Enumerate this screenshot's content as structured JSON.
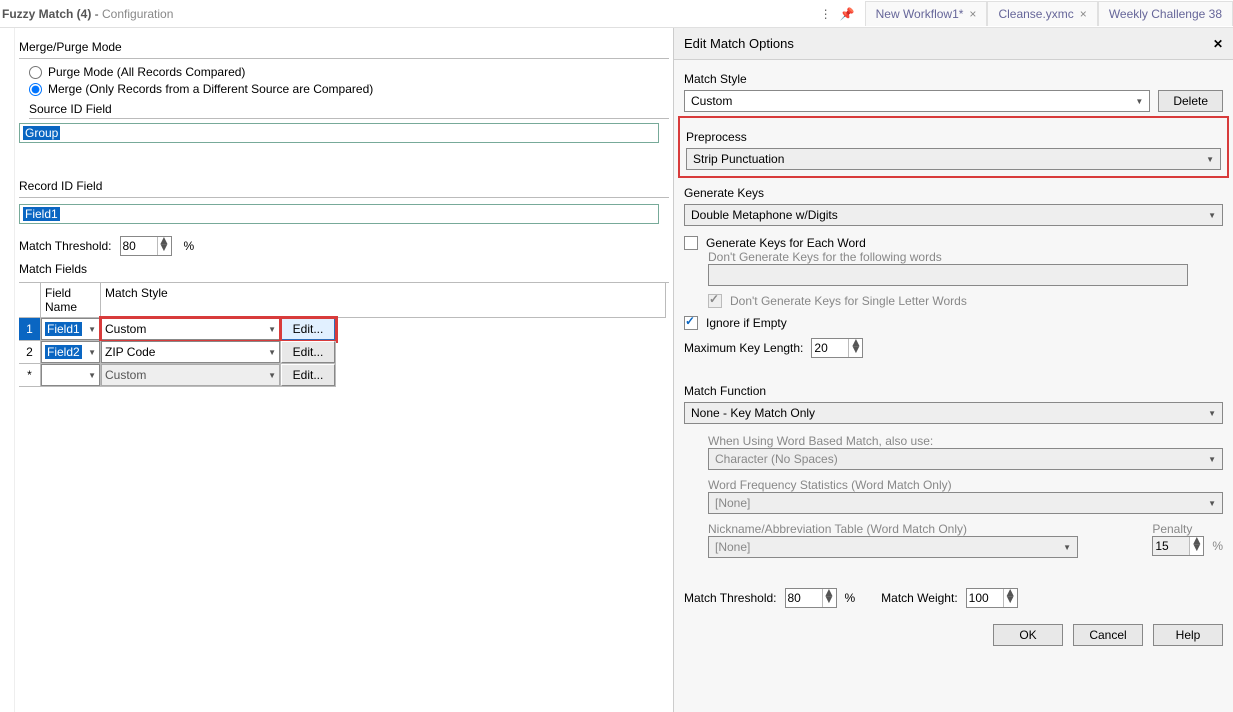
{
  "top": {
    "title_main": "Fuzzy Match (4)",
    "title_sep": " - ",
    "title_sub": "Configuration",
    "tabs": [
      {
        "label": "New Workflow1* ",
        "closable": true
      },
      {
        "label": "Cleanse.yxmc ",
        "closable": true
      },
      {
        "label": "Weekly Challenge 38",
        "closable": false
      }
    ]
  },
  "left": {
    "merge_section": "Merge/Purge Mode",
    "radio_purge": "Purge Mode (All Records Compared)",
    "radio_merge": "Merge (Only Records from a Different Source are Compared)",
    "sourceid_label": "Source ID Field",
    "sourceid_value": "Group",
    "recordid_label": "Record ID Field",
    "recordid_value": "Field1",
    "match_threshold_label": "Match Threshold:",
    "match_threshold_value": "80",
    "match_fields_label": "Match Fields",
    "columns": {
      "h1": "Field Name",
      "h2": "Match Style"
    },
    "rows": [
      {
        "n": "1",
        "field": "Field1",
        "style": "Custom",
        "edit": "Edit..."
      },
      {
        "n": "2",
        "field": "Field2",
        "style": "ZIP Code",
        "edit": "Edit..."
      },
      {
        "n": "*",
        "field": "",
        "style": "Custom",
        "edit": "Edit..."
      }
    ]
  },
  "right": {
    "header": "Edit Match Options",
    "match_style_label": "Match Style",
    "match_style_value": "Custom",
    "delete_btn": "Delete",
    "preprocess_label": "Preprocess",
    "preprocess_value": "Strip Punctuation",
    "genkeys_label": "Generate Keys",
    "genkeys_value": "Double Metaphone w/Digits",
    "gen_each_word": "Generate Keys for Each Word",
    "dont_generate_label": "Don't Generate Keys for the following words",
    "dont_generate_value": "",
    "single_letter": "Don't Generate Keys for Single Letter Words",
    "ignore_empty": "Ignore if Empty",
    "max_key_len_label": "Maximum Key Length:",
    "max_key_len_value": "20",
    "match_function_label": "Match Function",
    "match_function_value": "None - Key Match Only",
    "word_based_label": "When Using Word Based Match, also use:",
    "word_based_value": "Character (No Spaces)",
    "wordfreq_label": "Word Frequency Statistics (Word Match Only)",
    "wordfreq_value": "[None]",
    "nickname_label": "Nickname/Abbreviation Table (Word Match Only)",
    "nickname_value": "[None]",
    "penalty_label": "Penalty",
    "penalty_value": "15",
    "pct": "%",
    "mth_label": "Match Threshold:",
    "mth_value": "80",
    "mw_label": "Match Weight:",
    "mw_value": "100",
    "ok": "OK",
    "cancel": "Cancel",
    "help": "Help"
  }
}
